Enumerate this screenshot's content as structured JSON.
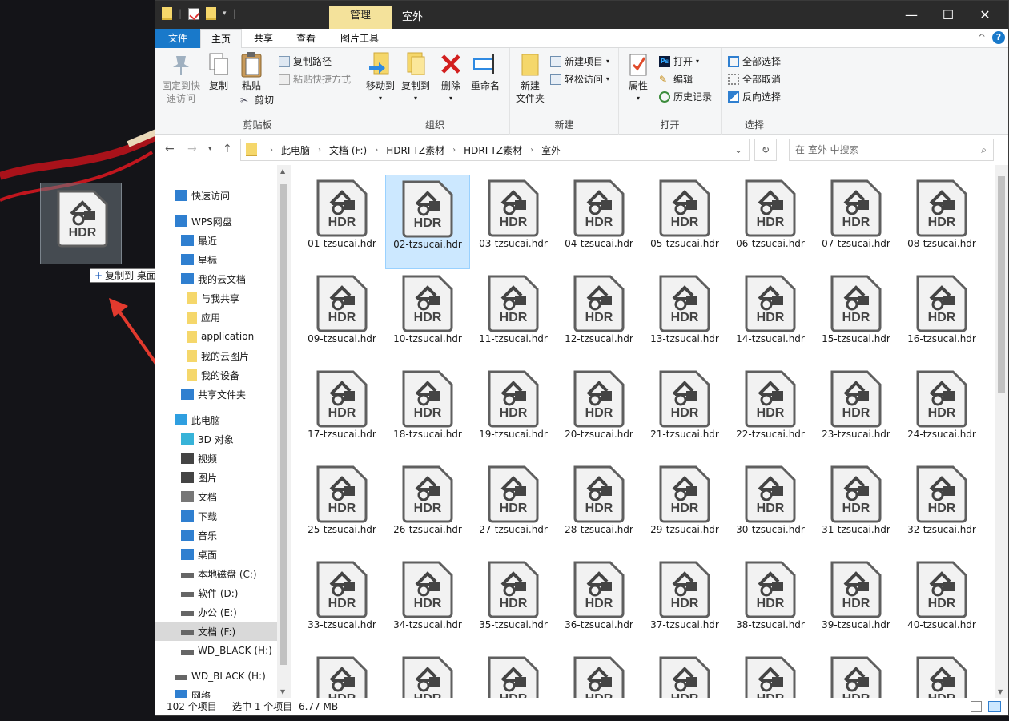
{
  "drag": {
    "ghost_label": "HDR",
    "tooltip_plus": "+",
    "tooltip_action": "复制到",
    "tooltip_target": "桌面"
  },
  "window": {
    "context_tab": "管理",
    "title": "室外",
    "controls": {
      "minimize": "—",
      "maximize": "☐",
      "close": "✕"
    }
  },
  "tabs": {
    "file": "文件",
    "home": "主页",
    "share": "共享",
    "view": "查看",
    "picture_tools": "图片工具",
    "collapse": "^",
    "help": "?"
  },
  "ribbon": {
    "clipboard": {
      "label": "剪贴板",
      "pin": "固定到快\n速访问",
      "copy": "复制",
      "paste": "粘贴",
      "copy_path": "复制路径",
      "paste_shortcut": "粘贴快捷方式",
      "cut": "剪切"
    },
    "organize": {
      "label": "组织",
      "move_to": "移动到",
      "copy_to": "复制到",
      "delete": "删除",
      "rename": "重命名"
    },
    "new": {
      "label": "新建",
      "new_folder": "新建\n文件夹",
      "new_item": "新建项目",
      "easy_access": "轻松访问"
    },
    "open": {
      "label": "打开",
      "properties": "属性",
      "open": "打开",
      "edit": "编辑",
      "history": "历史记录"
    },
    "select": {
      "label": "选择",
      "select_all": "全部选择",
      "select_none": "全部取消",
      "invert": "反向选择"
    }
  },
  "address": {
    "crumbs": [
      "此电脑",
      "文档 (F:)",
      "HDRI-TZ素材",
      "HDRI-TZ素材",
      "室外"
    ],
    "search_placeholder": "在 室外 中搜索"
  },
  "navpane": [
    {
      "label": "快速访问",
      "icon": "star-icon"
    },
    {
      "label": "WPS网盘",
      "icon": "cloud-icon"
    },
    {
      "label": "最近",
      "icon": "clock-icon"
    },
    {
      "label": "星标",
      "icon": "star-icon"
    },
    {
      "label": "我的云文档",
      "icon": "cloud-icon"
    },
    {
      "label": "与我共享",
      "icon": "folder-icon"
    },
    {
      "label": "应用",
      "icon": "folder-icon"
    },
    {
      "label": "application",
      "icon": "folder-icon"
    },
    {
      "label": "我的云图片",
      "icon": "folder-icon"
    },
    {
      "label": "我的设备",
      "icon": "folder-icon"
    },
    {
      "label": "共享文件夹",
      "icon": "share-icon"
    },
    {
      "label": "此电脑",
      "icon": "pc-icon"
    },
    {
      "label": "3D 对象",
      "icon": "cube-icon"
    },
    {
      "label": "视频",
      "icon": "video-icon"
    },
    {
      "label": "图片",
      "icon": "picture-icon"
    },
    {
      "label": "文档",
      "icon": "document-icon"
    },
    {
      "label": "下载",
      "icon": "download-icon"
    },
    {
      "label": "音乐",
      "icon": "music-icon"
    },
    {
      "label": "桌面",
      "icon": "desktop-icon"
    },
    {
      "label": "本地磁盘 (C:)",
      "icon": "drive-icon"
    },
    {
      "label": "软件 (D:)",
      "icon": "drive-icon"
    },
    {
      "label": "办公 (E:)",
      "icon": "drive-icon"
    },
    {
      "label": "文档 (F:)",
      "icon": "drive-icon",
      "selected": true
    },
    {
      "label": "WD_BLACK (H:)",
      "icon": "drive-icon"
    },
    {
      "label": "WD_BLACK (H:)",
      "icon": "drive-icon"
    },
    {
      "label": "网络",
      "icon": "network-icon"
    }
  ],
  "files": {
    "icon_label": "HDR",
    "items": [
      "01-tzsucai.hdr",
      "02-tzsucai.hdr",
      "03-tzsucai.hdr",
      "04-tzsucai.hdr",
      "05-tzsucai.hdr",
      "06-tzsucai.hdr",
      "07-tzsucai.hdr",
      "08-tzsucai.hdr",
      "09-tzsucai.hdr",
      "10-tzsucai.hdr",
      "11-tzsucai.hdr",
      "12-tzsucai.hdr",
      "13-tzsucai.hdr",
      "14-tzsucai.hdr",
      "15-tzsucai.hdr",
      "16-tzsucai.hdr",
      "17-tzsucai.hdr",
      "18-tzsucai.hdr",
      "19-tzsucai.hdr",
      "20-tzsucai.hdr",
      "21-tzsucai.hdr",
      "22-tzsucai.hdr",
      "23-tzsucai.hdr",
      "24-tzsucai.hdr",
      "25-tzsucai.hdr",
      "26-tzsucai.hdr",
      "27-tzsucai.hdr",
      "28-tzsucai.hdr",
      "29-tzsucai.hdr",
      "30-tzsucai.hdr",
      "31-tzsucai.hdr",
      "32-tzsucai.hdr",
      "33-tzsucai.hdr",
      "34-tzsucai.hdr",
      "35-tzsucai.hdr",
      "36-tzsucai.hdr",
      "37-tzsucai.hdr",
      "38-tzsucai.hdr",
      "39-tzsucai.hdr",
      "40-tzsucai.hdr",
      "",
      "",
      "",
      "",
      "",
      "",
      "",
      ""
    ],
    "selected_index": 1
  },
  "status": {
    "count": "102 个项目",
    "selection": "选中 1 个项目",
    "size": "6.77 MB"
  },
  "colors": {
    "accent": "#1979ca",
    "selection_bg": "#cce8ff",
    "context_tab": "#f4e29b",
    "titlebar": "#2b2b2b"
  }
}
